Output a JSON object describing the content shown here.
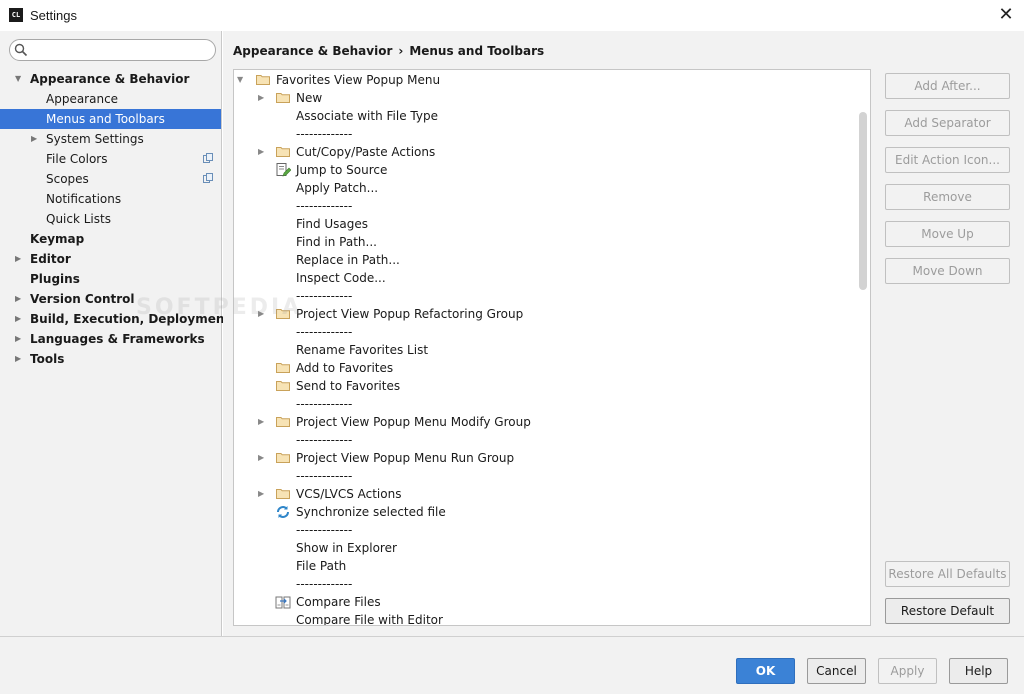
{
  "window": {
    "app_icon_text": "CL",
    "title": "Settings"
  },
  "search": {
    "placeholder": "",
    "value": ""
  },
  "sidebar": {
    "items": [
      {
        "label": "Appearance & Behavior",
        "bold": true,
        "arrow": "down",
        "indent": 0,
        "selected": false
      },
      {
        "label": "Appearance",
        "bold": false,
        "arrow": "",
        "indent": 1,
        "selected": false
      },
      {
        "label": "Menus and Toolbars",
        "bold": false,
        "arrow": "",
        "indent": 1,
        "selected": true
      },
      {
        "label": "System Settings",
        "bold": false,
        "arrow": "right",
        "indent": 1,
        "selected": false
      },
      {
        "label": "File Colors",
        "bold": false,
        "arrow": "",
        "indent": 1,
        "selected": false,
        "badge": "copy-icon"
      },
      {
        "label": "Scopes",
        "bold": false,
        "arrow": "",
        "indent": 1,
        "selected": false,
        "badge": "copy-icon"
      },
      {
        "label": "Notifications",
        "bold": false,
        "arrow": "",
        "indent": 1,
        "selected": false
      },
      {
        "label": "Quick Lists",
        "bold": false,
        "arrow": "",
        "indent": 1,
        "selected": false
      },
      {
        "label": "Keymap",
        "bold": true,
        "arrow": "",
        "indent": 0,
        "selected": false
      },
      {
        "label": "Editor",
        "bold": true,
        "arrow": "right",
        "indent": 0,
        "selected": false
      },
      {
        "label": "Plugins",
        "bold": true,
        "arrow": "",
        "indent": 0,
        "selected": false
      },
      {
        "label": "Version Control",
        "bold": true,
        "arrow": "right",
        "indent": 0,
        "selected": false
      },
      {
        "label": "Build, Execution, Deployment",
        "bold": true,
        "arrow": "right",
        "indent": 0,
        "selected": false
      },
      {
        "label": "Languages & Frameworks",
        "bold": true,
        "arrow": "right",
        "indent": 0,
        "selected": false
      },
      {
        "label": "Tools",
        "bold": true,
        "arrow": "right",
        "indent": 0,
        "selected": false
      }
    ]
  },
  "breadcrumb": {
    "parent": "Appearance & Behavior",
    "separator": "›",
    "current": "Menus and Toolbars"
  },
  "tree": {
    "root": {
      "label": "Favorites View Popup Menu",
      "icon": "folder-icon",
      "arrow": "down"
    },
    "rows": [
      {
        "label": "New",
        "icon": "folder-icon",
        "arrow": "right"
      },
      {
        "label": "Associate with File Type",
        "icon": "",
        "arrow": ""
      },
      {
        "label": "-------------",
        "icon": "",
        "arrow": ""
      },
      {
        "label": "Cut/Copy/Paste Actions",
        "icon": "folder-icon",
        "arrow": "right"
      },
      {
        "label": "Jump to Source",
        "icon": "edit-source-icon",
        "arrow": ""
      },
      {
        "label": "Apply Patch...",
        "icon": "",
        "arrow": ""
      },
      {
        "label": "-------------",
        "icon": "",
        "arrow": ""
      },
      {
        "label": "Find Usages",
        "icon": "",
        "arrow": ""
      },
      {
        "label": "Find in Path...",
        "icon": "",
        "arrow": ""
      },
      {
        "label": "Replace in Path...",
        "icon": "",
        "arrow": ""
      },
      {
        "label": "Inspect Code...",
        "icon": "",
        "arrow": ""
      },
      {
        "label": "-------------",
        "icon": "",
        "arrow": ""
      },
      {
        "label": "Project View Popup Refactoring Group",
        "icon": "folder-icon",
        "arrow": "right"
      },
      {
        "label": "-------------",
        "icon": "",
        "arrow": ""
      },
      {
        "label": "Rename Favorites List",
        "icon": "",
        "arrow": ""
      },
      {
        "label": "Add to Favorites",
        "icon": "folder-icon",
        "arrow": ""
      },
      {
        "label": "Send to Favorites",
        "icon": "folder-icon",
        "arrow": ""
      },
      {
        "label": "-------------",
        "icon": "",
        "arrow": ""
      },
      {
        "label": "Project View Popup Menu Modify Group",
        "icon": "folder-icon",
        "arrow": "right"
      },
      {
        "label": "-------------",
        "icon": "",
        "arrow": ""
      },
      {
        "label": "Project View Popup Menu Run Group",
        "icon": "folder-icon",
        "arrow": "right"
      },
      {
        "label": "-------------",
        "icon": "",
        "arrow": ""
      },
      {
        "label": "VCS/LVCS Actions",
        "icon": "folder-icon",
        "arrow": "right"
      },
      {
        "label": "Synchronize selected file",
        "icon": "sync-icon",
        "arrow": ""
      },
      {
        "label": "-------------",
        "icon": "",
        "arrow": ""
      },
      {
        "label": "Show in Explorer",
        "icon": "",
        "arrow": ""
      },
      {
        "label": "File Path",
        "icon": "",
        "arrow": ""
      },
      {
        "label": "-------------",
        "icon": "",
        "arrow": ""
      },
      {
        "label": "Compare Files",
        "icon": "compare-icon",
        "arrow": ""
      },
      {
        "label": "Compare File with Editor",
        "icon": "",
        "arrow": ""
      }
    ]
  },
  "actions": {
    "add_after": "Add After...",
    "add_separator": "Add Separator",
    "edit_action_icon": "Edit Action Icon...",
    "remove": "Remove",
    "move_up": "Move Up",
    "move_down": "Move Down",
    "restore_all_defaults": "Restore All Defaults",
    "restore_default": "Restore Default"
  },
  "footer": {
    "ok": "OK",
    "cancel": "Cancel",
    "apply": "Apply",
    "help": "Help"
  },
  "watermark": "SOFTPEDIA",
  "colors": {
    "selection": "#3875d7",
    "primary_button": "#3b82d6",
    "folder": "#c9a25a"
  }
}
